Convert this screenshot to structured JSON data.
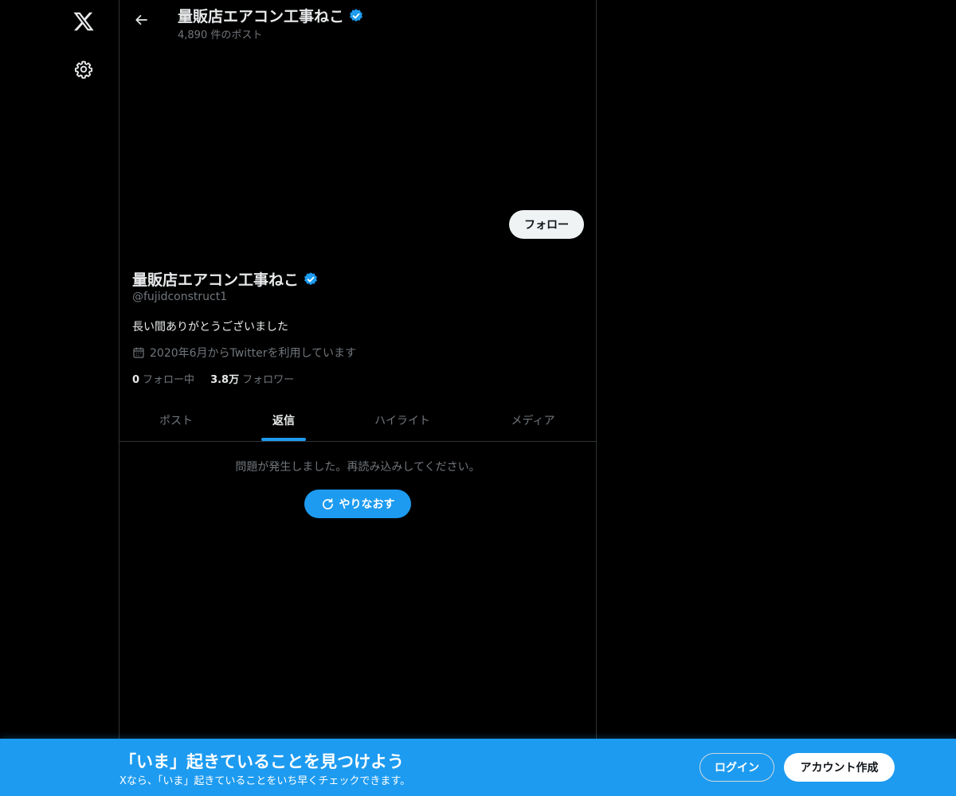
{
  "nav": {
    "logo_icon": "x-logo-icon",
    "settings_icon": "gear-icon"
  },
  "header": {
    "title": "量販店エアコン工事ねこ",
    "post_count": "4,890 件のポスト"
  },
  "profile": {
    "follow_label": "フォロー",
    "name": "量販店エアコン工事ねこ",
    "handle": "@fujidconstruct1",
    "bio": "長い間ありがとうございました",
    "joined": "2020年6月からTwitterを利用しています",
    "following_count": "0",
    "following_label": "フォロー中",
    "followers_count": "3.8万",
    "followers_label": "フォロワー"
  },
  "tabs": [
    {
      "label": "ポスト",
      "active": false
    },
    {
      "label": "返信",
      "active": true
    },
    {
      "label": "ハイライト",
      "active": false
    },
    {
      "label": "メディア",
      "active": false
    }
  ],
  "content": {
    "error_message": "問題が発生しました。再読み込みしてください。",
    "retry_label": "やりなおす"
  },
  "bottom_bar": {
    "title": "「いま」起きていることを見つけよう",
    "subtitle": "Xなら、「いま」起きていることをいち早くチェックできます。",
    "login_label": "ログイン",
    "signup_label": "アカウント作成"
  },
  "colors": {
    "accent": "#1d9bf0",
    "background": "#000000",
    "text_primary": "#e7e9ea",
    "text_secondary": "#71767b",
    "border": "#2f3336"
  }
}
